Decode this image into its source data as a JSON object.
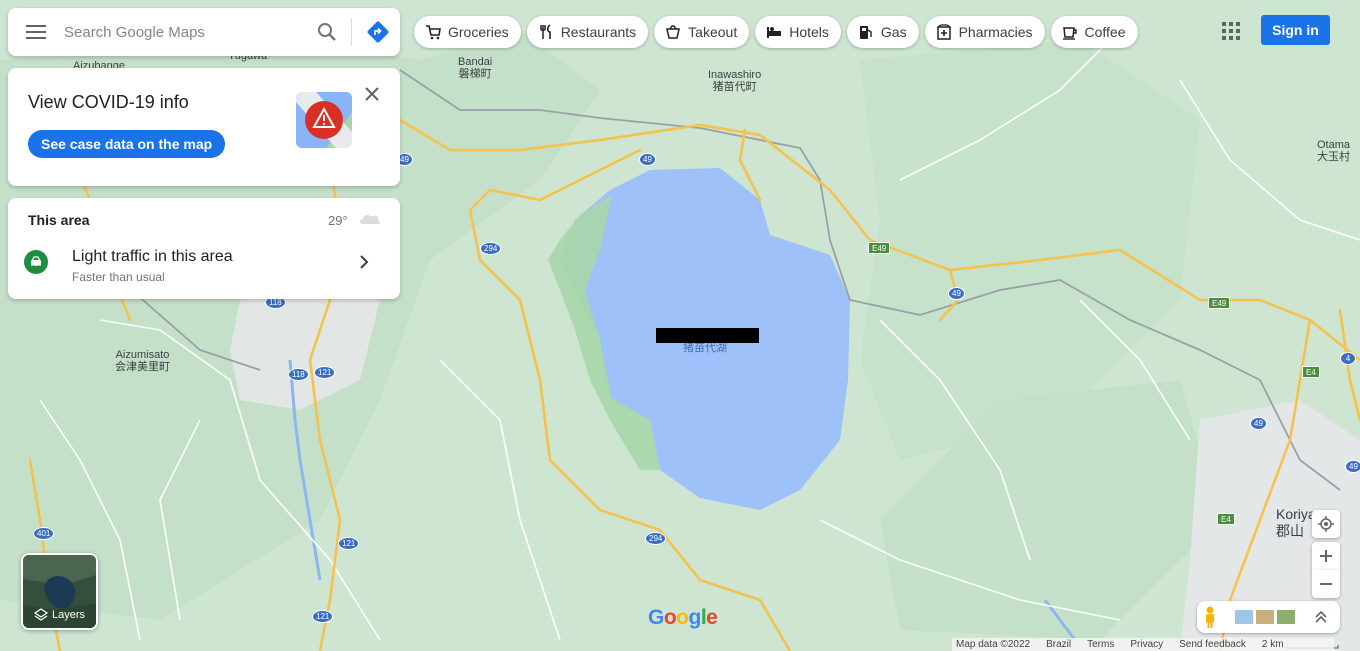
{
  "search": {
    "placeholder": "Search Google Maps"
  },
  "chips": [
    {
      "label": "Groceries",
      "icon": "cart-icon"
    },
    {
      "label": "Restaurants",
      "icon": "fork-knife-icon"
    },
    {
      "label": "Takeout",
      "icon": "takeout-bag-icon"
    },
    {
      "label": "Hotels",
      "icon": "bed-icon"
    },
    {
      "label": "Gas",
      "icon": "gas-pump-icon"
    },
    {
      "label": "Pharmacies",
      "icon": "pharmacy-icon"
    },
    {
      "label": "Coffee",
      "icon": "coffee-cup-icon"
    }
  ],
  "header": {
    "signin_label": "Sign in"
  },
  "covid": {
    "title": "View COVID-19 info",
    "link_label": "See case data on the map"
  },
  "area": {
    "title": "This area",
    "temperature": "29°",
    "traffic_title": "Light traffic in this area",
    "traffic_subtitle": "Faster than usual"
  },
  "layers": {
    "label": "Layers"
  },
  "map_labels": {
    "bandai_en": "Bandai",
    "bandai_jp": "磐梯町",
    "inawashiro_en": "Inawashiro",
    "inawashiro_jp": "猪苗代町",
    "otama_en": "Otama",
    "otama_jp": "大玉村",
    "aizubange": "Aizubange",
    "yugawa": "Yugawa",
    "aizumisato_en": "Aizumisato",
    "aizumisato_jp": "会津美里町",
    "koriyama_en": "Koriyama",
    "koriyama_jp": "郡山",
    "lake_jp": "猪苗代湖"
  },
  "road_shields": [
    "49",
    "49",
    "49",
    "49",
    "294",
    "294",
    "118",
    "118",
    "121",
    "121",
    "121",
    "401",
    "E49",
    "E49",
    "E4",
    "E4",
    "4",
    "49"
  ],
  "footer": {
    "map_data": "Map data ©2022",
    "region": "Brazil",
    "terms": "Terms",
    "privacy": "Privacy",
    "feedback": "Send feedback",
    "scale": "2 km"
  },
  "colors": {
    "accent": "#1a73e8",
    "lake": "#9cc0f9",
    "land": "#cfe6d3",
    "forest": "#a9dcae",
    "road_yellow": "#f6c34f",
    "traffic_green": "#1e8e3e",
    "covid_red": "#d93025"
  }
}
